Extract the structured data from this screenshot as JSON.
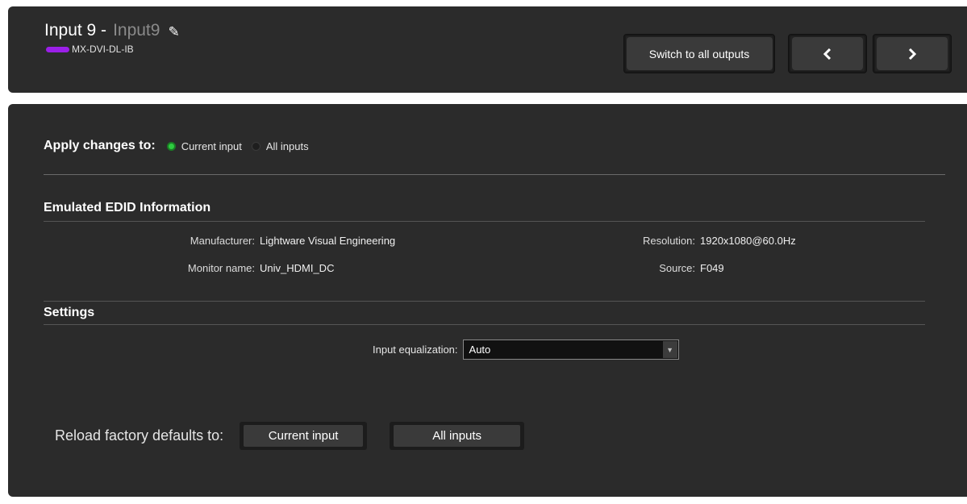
{
  "header": {
    "title_prefix": "Input 9 -",
    "input_name": "Input9",
    "edit_icon": "pencil-icon",
    "device_color": "#9b1fe8",
    "device_name": "MX-DVI-DL-IB",
    "switch_all_label": "Switch to all outputs",
    "prev_glyph": "‹",
    "next_glyph": "›"
  },
  "apply": {
    "label": "Apply changes to:",
    "options": [
      {
        "label": "Current input",
        "selected": true
      },
      {
        "label": "All inputs",
        "selected": false
      }
    ]
  },
  "edid": {
    "title": "Emulated EDID Information",
    "left": [
      {
        "key": "Manufacturer:",
        "value": "Lightware Visual Engineering"
      },
      {
        "key": "Monitor name:",
        "value": "Univ_HDMI_DC"
      }
    ],
    "right": [
      {
        "key": "Resolution:",
        "value": "1920x1080@60.0Hz"
      },
      {
        "key": "Source:",
        "value": "F049"
      }
    ]
  },
  "settings": {
    "title": "Settings",
    "eq_label": "Input equalization:",
    "eq_value": "Auto"
  },
  "reload": {
    "label": "Reload factory defaults to:",
    "current_label": "Current input",
    "all_label": "All inputs"
  }
}
